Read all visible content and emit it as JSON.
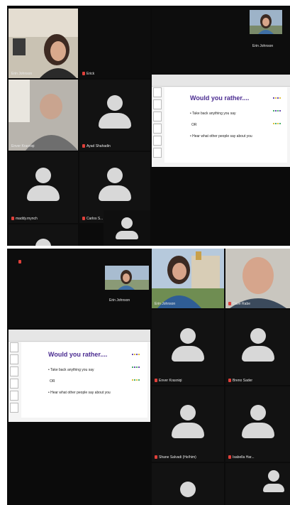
{
  "top_grid": {
    "tiles": [
      {
        "name": "Erin Johnson"
      },
      {
        "name": "Erick"
      },
      {
        "name": "Enver Krasniqi"
      },
      {
        "name": "Ayad Shahadin"
      },
      {
        "name": "maddy.mynch"
      },
      {
        "name": "Carlos S..."
      }
    ],
    "self_view_name": "Erin Johnson"
  },
  "top_slide": {
    "title": "Would you rather....",
    "option1": "•  Take back anything you say",
    "or": "OR",
    "option2": "•  Hear what other people say about you"
  },
  "bottom_grid": {
    "floating_name": "Erin Johnson",
    "tiles": [
      {
        "name": "Erin Johnson"
      },
      {
        "name": "Dave Rabe"
      },
      {
        "name": "Enver Krasniqi"
      },
      {
        "name": "Breno Sader"
      },
      {
        "name": "Shane Salvadi (He/him)"
      },
      {
        "name": "Isabella Har..."
      }
    ]
  },
  "bottom_slide": {
    "title": "Would you rather....",
    "option1": "•  Take back anything you say",
    "or": "OR",
    "option2": "•  Hear what other people say about you"
  },
  "colors": {
    "active_border": "#3ecf5c",
    "title_purple": "#4b2c91",
    "muted_mic": "#e0403a"
  }
}
